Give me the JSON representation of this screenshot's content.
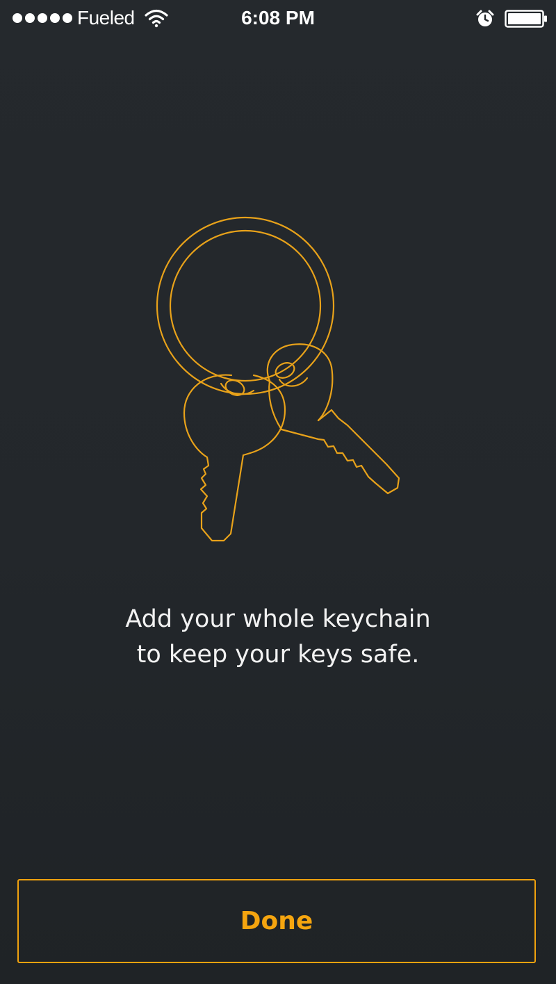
{
  "status_bar": {
    "carrier": "Fueled",
    "time": "6:08 PM",
    "icons": [
      "signal-dots-icon",
      "wifi-icon",
      "alarm-clock-icon",
      "battery-icon"
    ]
  },
  "illustration": {
    "icon": "keychain-icon",
    "stroke_color": "#e8a21a"
  },
  "message": {
    "line1": "Add your whole keychain",
    "line2": "to keep your keys safe."
  },
  "done_button": {
    "label": "Done",
    "accent_color": "#f5a50f"
  },
  "colors": {
    "background": "#23272a",
    "text": "#f2f2f2"
  }
}
